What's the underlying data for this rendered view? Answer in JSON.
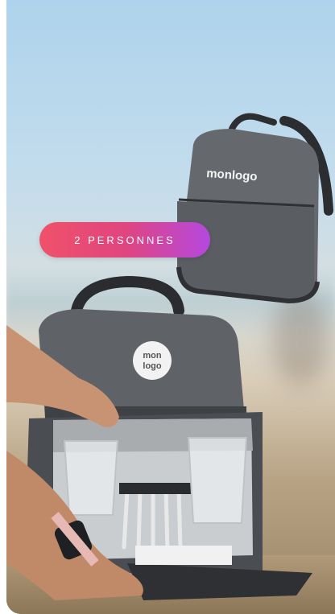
{
  "badge": {
    "label": "2 PERSONNES"
  },
  "product_small": {
    "logo_text": "monlogo"
  },
  "product_large": {
    "logo_text_line1": "mon",
    "logo_text_line2": "logo"
  },
  "colors": {
    "badge_start": "#f0516a",
    "badge_end": "#b548e0",
    "bag_fabric": "#5d6166"
  }
}
